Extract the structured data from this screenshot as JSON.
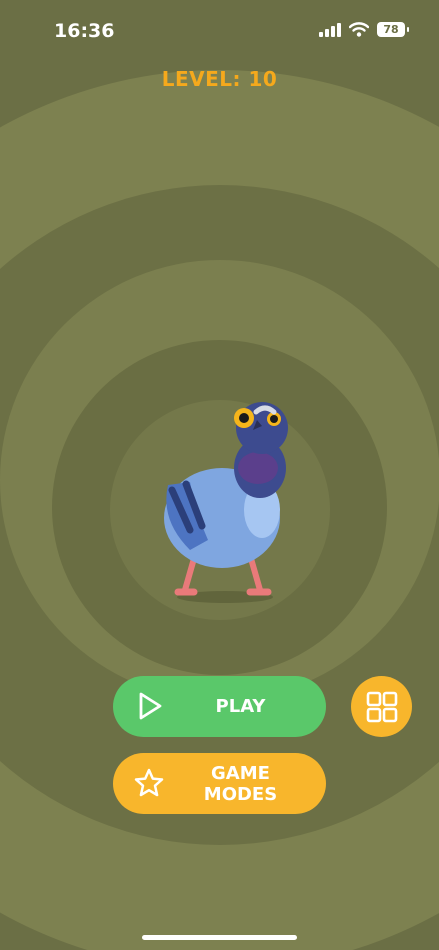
{
  "status_bar": {
    "time": "16:36",
    "battery": "78"
  },
  "header": {
    "level_text": "LEVEL: 10"
  },
  "buttons": {
    "play_label": "PLAY",
    "game_modes_label": "GAME MODES"
  },
  "icons": {
    "play": "play-triangle-icon",
    "game_modes": "star-icon",
    "menu": "grid-icon",
    "signal": "cellular-signal-icon",
    "wifi": "wifi-icon",
    "battery": "battery-icon"
  },
  "colors": {
    "background": "#6b6f45",
    "level_text": "#f5a91c",
    "play_button": "#5ac86a",
    "game_modes_button": "#f8b62c",
    "grid_button": "#f8b62c"
  }
}
